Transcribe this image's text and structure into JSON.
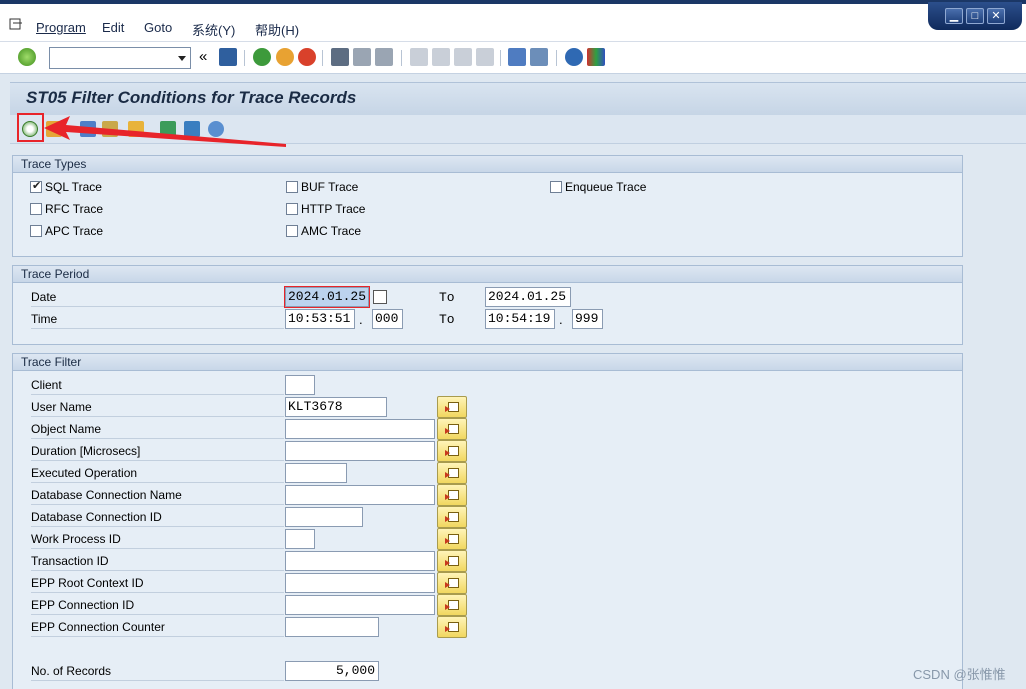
{
  "menu": {
    "items": [
      "Program",
      "Edit",
      "Goto",
      "系统(Y)",
      "帮助(H)"
    ]
  },
  "window_controls": [
    "minimize",
    "maximize",
    "close"
  ],
  "toolbar": {
    "command_field_value": "",
    "icons": [
      "ok-check-icon",
      "collapse-icon",
      "save-icon",
      "back-icon",
      "exit-icon",
      "cancel-icon",
      "print-icon",
      "find-icon",
      "find-next-icon",
      "first-page-icon",
      "prev-page-icon",
      "next-page-icon",
      "last-page-icon",
      "new-session-icon",
      "shortcut-icon",
      "help-icon",
      "customize-layout-icon"
    ]
  },
  "page": {
    "title": "ST05 Filter Conditions for Trace Records"
  },
  "app_toolbar": {
    "icons": [
      "execute-icon",
      "variant-icon",
      "get-variant-icon",
      "display-icon",
      "save-variant-icon",
      "download-icon",
      "upload-icon",
      "database-icon"
    ]
  },
  "trace_types": {
    "title": "Trace Types",
    "options": [
      {
        "label": "SQL Trace",
        "checked": true
      },
      {
        "label": "BUF Trace",
        "checked": false
      },
      {
        "label": "Enqueue Trace",
        "checked": false
      },
      {
        "label": "RFC Trace",
        "checked": false
      },
      {
        "label": "HTTP Trace",
        "checked": false
      },
      {
        "label": "APC Trace",
        "checked": false
      },
      {
        "label": "AMC Trace",
        "checked": false
      }
    ]
  },
  "trace_period": {
    "title": "Trace Period",
    "date_label": "Date",
    "time_label": "Time",
    "to_label": "To",
    "date_from": "2024.01.25",
    "date_to": "2024.01.25",
    "time_from": "10:53:51",
    "time_from_ms": "000",
    "time_to": "10:54:19",
    "time_to_ms": "999",
    "dot": "."
  },
  "trace_filter": {
    "title": "Trace Filter",
    "fields": [
      {
        "label": "Client",
        "value": ""
      },
      {
        "label": "User Name",
        "value": "KLT3678"
      },
      {
        "label": "Object Name",
        "value": ""
      },
      {
        "label": "Duration [Microsecs]",
        "value": ""
      },
      {
        "label": "Executed Operation",
        "value": ""
      },
      {
        "label": "Database Connection Name",
        "value": ""
      },
      {
        "label": "Database Connection ID",
        "value": ""
      },
      {
        "label": "Work Process ID",
        "value": ""
      },
      {
        "label": "Transaction ID",
        "value": ""
      },
      {
        "label": "EPP Root Context ID",
        "value": ""
      },
      {
        "label": "EPP Connection ID",
        "value": ""
      },
      {
        "label": "EPP Connection Counter",
        "value": ""
      }
    ],
    "records_label": "No. of Records",
    "records_value": "5,000"
  },
  "watermark": "CSDN @张惟惟",
  "colors": {
    "highlight": "#e8242a",
    "title_bg": "#c6d5e6",
    "group_header": "#c8d7e8"
  }
}
